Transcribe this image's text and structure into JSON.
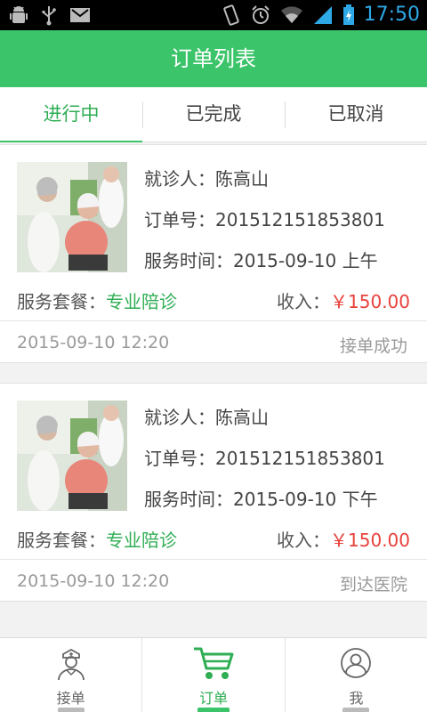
{
  "statusbar": {
    "time": "17:50"
  },
  "titlebar": {
    "title": "订单列表"
  },
  "tabs": [
    {
      "label": "进行中",
      "active": true
    },
    {
      "label": "已完成",
      "active": false
    },
    {
      "label": "已取消",
      "active": false
    }
  ],
  "orders": [
    {
      "patient_label": "就诊人：",
      "patient": "陈高山",
      "order_label": "订单号：",
      "order_no": "201512151853801",
      "time_label": "服务时间：",
      "service_time": "2015-09-10 上午",
      "package_label": "服务套餐：",
      "package": "专业陪诊",
      "income_label": "收入：",
      "income": "￥150.00",
      "created": "2015-09-10  12:20",
      "status": "接单成功"
    },
    {
      "patient_label": "就诊人：",
      "patient": "陈高山",
      "order_label": "订单号：",
      "order_no": "201512151853801",
      "time_label": "服务时间：",
      "service_time": "2015-09-10 下午",
      "package_label": "服务套餐：",
      "package": "专业陪诊",
      "income_label": "收入：",
      "income": "￥150.00",
      "created": "2015-09-10  12:20",
      "status": "到达医院"
    }
  ],
  "bottomnav": [
    {
      "label": "接单",
      "icon": "nurse-icon",
      "active": false
    },
    {
      "label": "订单",
      "icon": "cart-icon",
      "active": true
    },
    {
      "label": "我",
      "icon": "user-icon",
      "active": false
    }
  ],
  "colors": {
    "accent": "#3cc46a",
    "price": "#e8413b"
  }
}
